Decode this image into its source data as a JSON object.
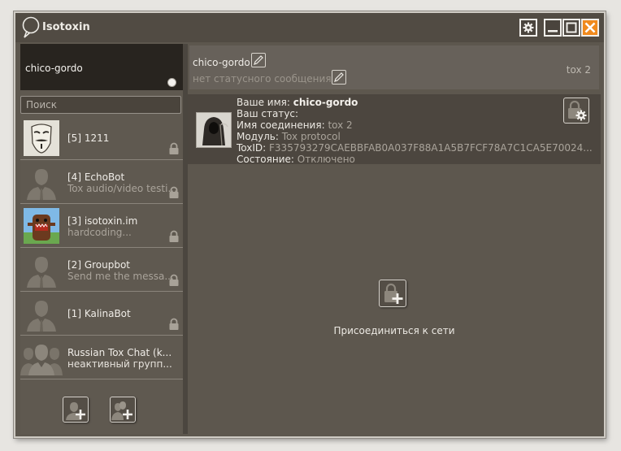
{
  "window": {
    "title": "Isotoxin"
  },
  "titlebar": {
    "settings_icon": "gear-icon",
    "minimize_icon": "minimize-icon",
    "maximize_icon": "maximize-icon",
    "close_icon": "close-icon",
    "close_color": "#f08a1e"
  },
  "profile": {
    "name": "chico-gordo",
    "status_dot_color": "#f4f2ee"
  },
  "search": {
    "placeholder": "Поиск",
    "value": ""
  },
  "contacts": [
    {
      "title": "[5] 1211",
      "subtitle": "",
      "avatar": "mask-avatar",
      "locked": true
    },
    {
      "title": "[4] EchoBot",
      "subtitle": "Tox audio/video testi...",
      "avatar": "person-silhouette",
      "locked": true
    },
    {
      "title": "[3] isotoxin.im",
      "subtitle": "hardcoding...",
      "avatar": "domo-avatar",
      "locked": true
    },
    {
      "title": "[2] Groupbot",
      "subtitle": "Send me the messa...",
      "avatar": "person-silhouette",
      "locked": true
    },
    {
      "title": "[1] KalinaBot",
      "subtitle": "",
      "avatar": "person-silhouette",
      "locked": true
    },
    {
      "title": "Russian Tox Chat (k...",
      "subtitle": "неактивный групп...",
      "avatar": "group-silhouette",
      "locked": false
    }
  ],
  "left_footer": {
    "add_contact_icon": "add-contact-icon",
    "add_group_icon": "add-group-icon"
  },
  "header": {
    "name": "chico-gordo",
    "status_message": "нет статусного сообщения",
    "protocol": "tox 2"
  },
  "info": {
    "name_label": "Ваше имя:",
    "name_value": "chico-gordo",
    "status_label": "Ваш статус:",
    "status_value": "",
    "connection_label": "Имя соединения:",
    "connection_value": "tox 2",
    "module_label": "Модуль:",
    "module_value": "Tox protocol",
    "toxid_label": "ToxID:",
    "toxid_value": "F335793279CAEBBFAB0A037F88A1A5B7FCF78A7C1CA5E70024...",
    "state_label": "Состояние:",
    "state_value": "Отключено"
  },
  "connect": {
    "label": "Присоединиться к сети"
  }
}
